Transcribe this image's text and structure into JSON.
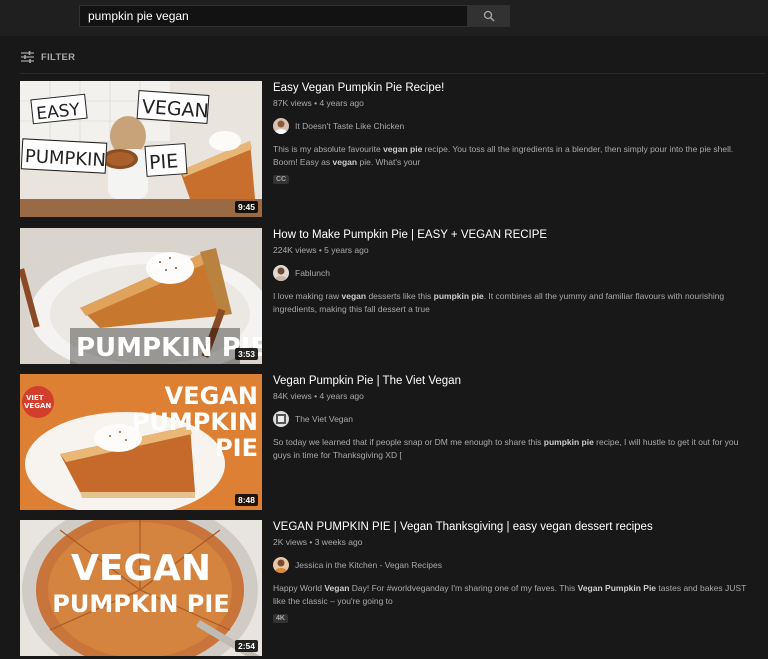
{
  "search": {
    "query": "pumpkin pie vegan"
  },
  "filter": {
    "label": "FILTER"
  },
  "colors": {
    "background": "#181818",
    "topbar": "#1f1f1f",
    "muted_text": "#aaaaaa"
  },
  "results": [
    {
      "title": "Easy Vegan Pumpkin Pie Recipe!",
      "views": "87K views",
      "age": "4 years ago",
      "channel": "It Doesn't Taste Like Chicken",
      "description_parts": [
        {
          "t": "This is my absolute favourite ",
          "b": false
        },
        {
          "t": "vegan",
          "b": true
        },
        {
          "t": " ",
          "b": false
        },
        {
          "t": "pie",
          "b": true
        },
        {
          "t": " recipe. You toss all the ingredients in a blender, then simply pour into the pie shell. Boom! Easy as ",
          "b": false
        },
        {
          "t": "vegan",
          "b": true
        },
        {
          "t": " pie. What's your",
          "b": false
        }
      ],
      "badge": "CC",
      "duration": "9:45",
      "thumb_words": [
        "EASY",
        "VEGAN",
        "PUMPKIN",
        "PIE"
      ]
    },
    {
      "title": "How to Make Pumpkin Pie | EASY + VEGAN RECIPE",
      "views": "224K views",
      "age": "5 years ago",
      "channel": "Fablunch",
      "description_parts": [
        {
          "t": "I love making raw ",
          "b": false
        },
        {
          "t": "vegan",
          "b": true
        },
        {
          "t": " desserts like this ",
          "b": false
        },
        {
          "t": "pumpkin pie",
          "b": true
        },
        {
          "t": ". It combines all the yummy and familiar flavours with nourishing ingredients, making this fall dessert a true",
          "b": false
        }
      ],
      "badge": "",
      "duration": "3:53",
      "thumb_words": [
        "PUMPKIN PIE"
      ]
    },
    {
      "title": "Vegan Pumpkin Pie | The Viet Vegan",
      "views": "84K views",
      "age": "4 years ago",
      "channel": "The Viet Vegan",
      "description_parts": [
        {
          "t": "So today we learned that if people snap or DM me enough to share this ",
          "b": false
        },
        {
          "t": "pumpkin pie",
          "b": true
        },
        {
          "t": " recipe, I will hustle to get it out for you guys in time for Thanksgiving XD [",
          "b": false
        }
      ],
      "badge": "",
      "duration": "8:48",
      "thumb_words": [
        "VEGAN",
        "PUMPKIN",
        "PIE",
        "VIET",
        "VEGAN"
      ]
    },
    {
      "title": "VEGAN PUMPKIN PIE | Vegan Thanksgiving | easy vegan dessert recipes",
      "views": "2K views",
      "age": "3 weeks ago",
      "channel": "Jessica in the Kitchen - Vegan Recipes",
      "description_parts": [
        {
          "t": "Happy World ",
          "b": false
        },
        {
          "t": "Vegan",
          "b": true
        },
        {
          "t": " Day! For #worldveganday I'm sharing one of my faves. This ",
          "b": false
        },
        {
          "t": "Vegan Pumpkin Pie",
          "b": true
        },
        {
          "t": " tastes and bakes JUST like the classic – you're going to",
          "b": false
        }
      ],
      "badge": "4K",
      "duration": "2:54",
      "thumb_words": [
        "VEGAN",
        "PUMPKIN PIE"
      ]
    }
  ]
}
